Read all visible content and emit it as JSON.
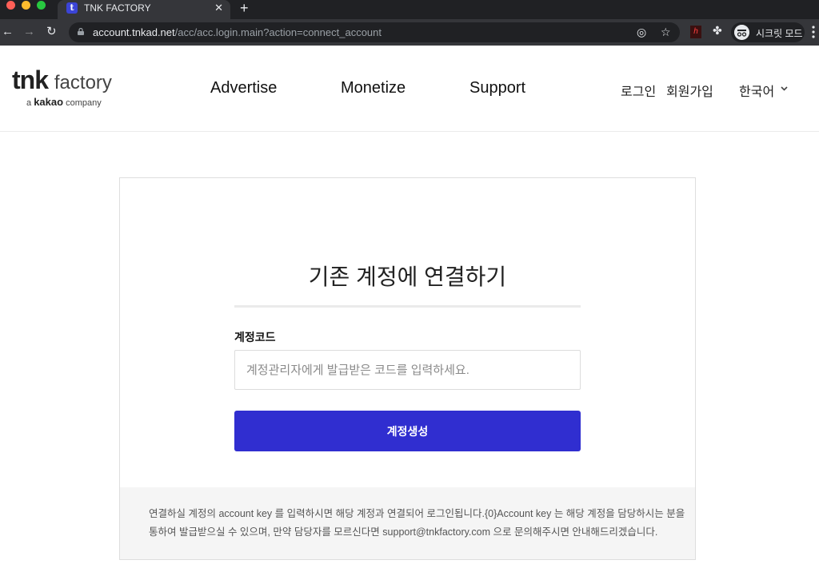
{
  "browser": {
    "tab_title": "TNK FACTORY",
    "tab_favicon": "t",
    "url_host": "account.tnkad.net",
    "url_path": "/acc/acc.login.main?action=connect_account",
    "incognito_label": "시크릿 모드"
  },
  "header": {
    "logo_bold": "tnk",
    "logo_light": "factory",
    "logo_sub_prefix": "a",
    "logo_sub_brand": "kakao",
    "logo_sub_suffix": "company",
    "nav": [
      "Advertise",
      "Monetize",
      "Support"
    ],
    "login": "로그인",
    "signup": "회원가입",
    "language": "한국어"
  },
  "card": {
    "title": "기존 계정에 연결하기",
    "field_label": "계정코드",
    "input_placeholder": "계정관리자에게 발급받은 코드를 입력하세요.",
    "input_value": "",
    "button_label": "계정생성",
    "footer_line1": "연결하실 계정의 account key 를 입력하시면 해당 계정과 연결되어 로그인됩니다.{0}Account key 는 해당 계정을 담당하시는 분을",
    "footer_line2": "통하여 발급받으실 수 있으며, 만약 담당자를 모르신다면 support@tnkfactory.com 으로 문의해주시면 안내해드리겠습니다."
  },
  "colors": {
    "primary_button": "#302ed0",
    "footer_bg": "#f5f5f5"
  }
}
